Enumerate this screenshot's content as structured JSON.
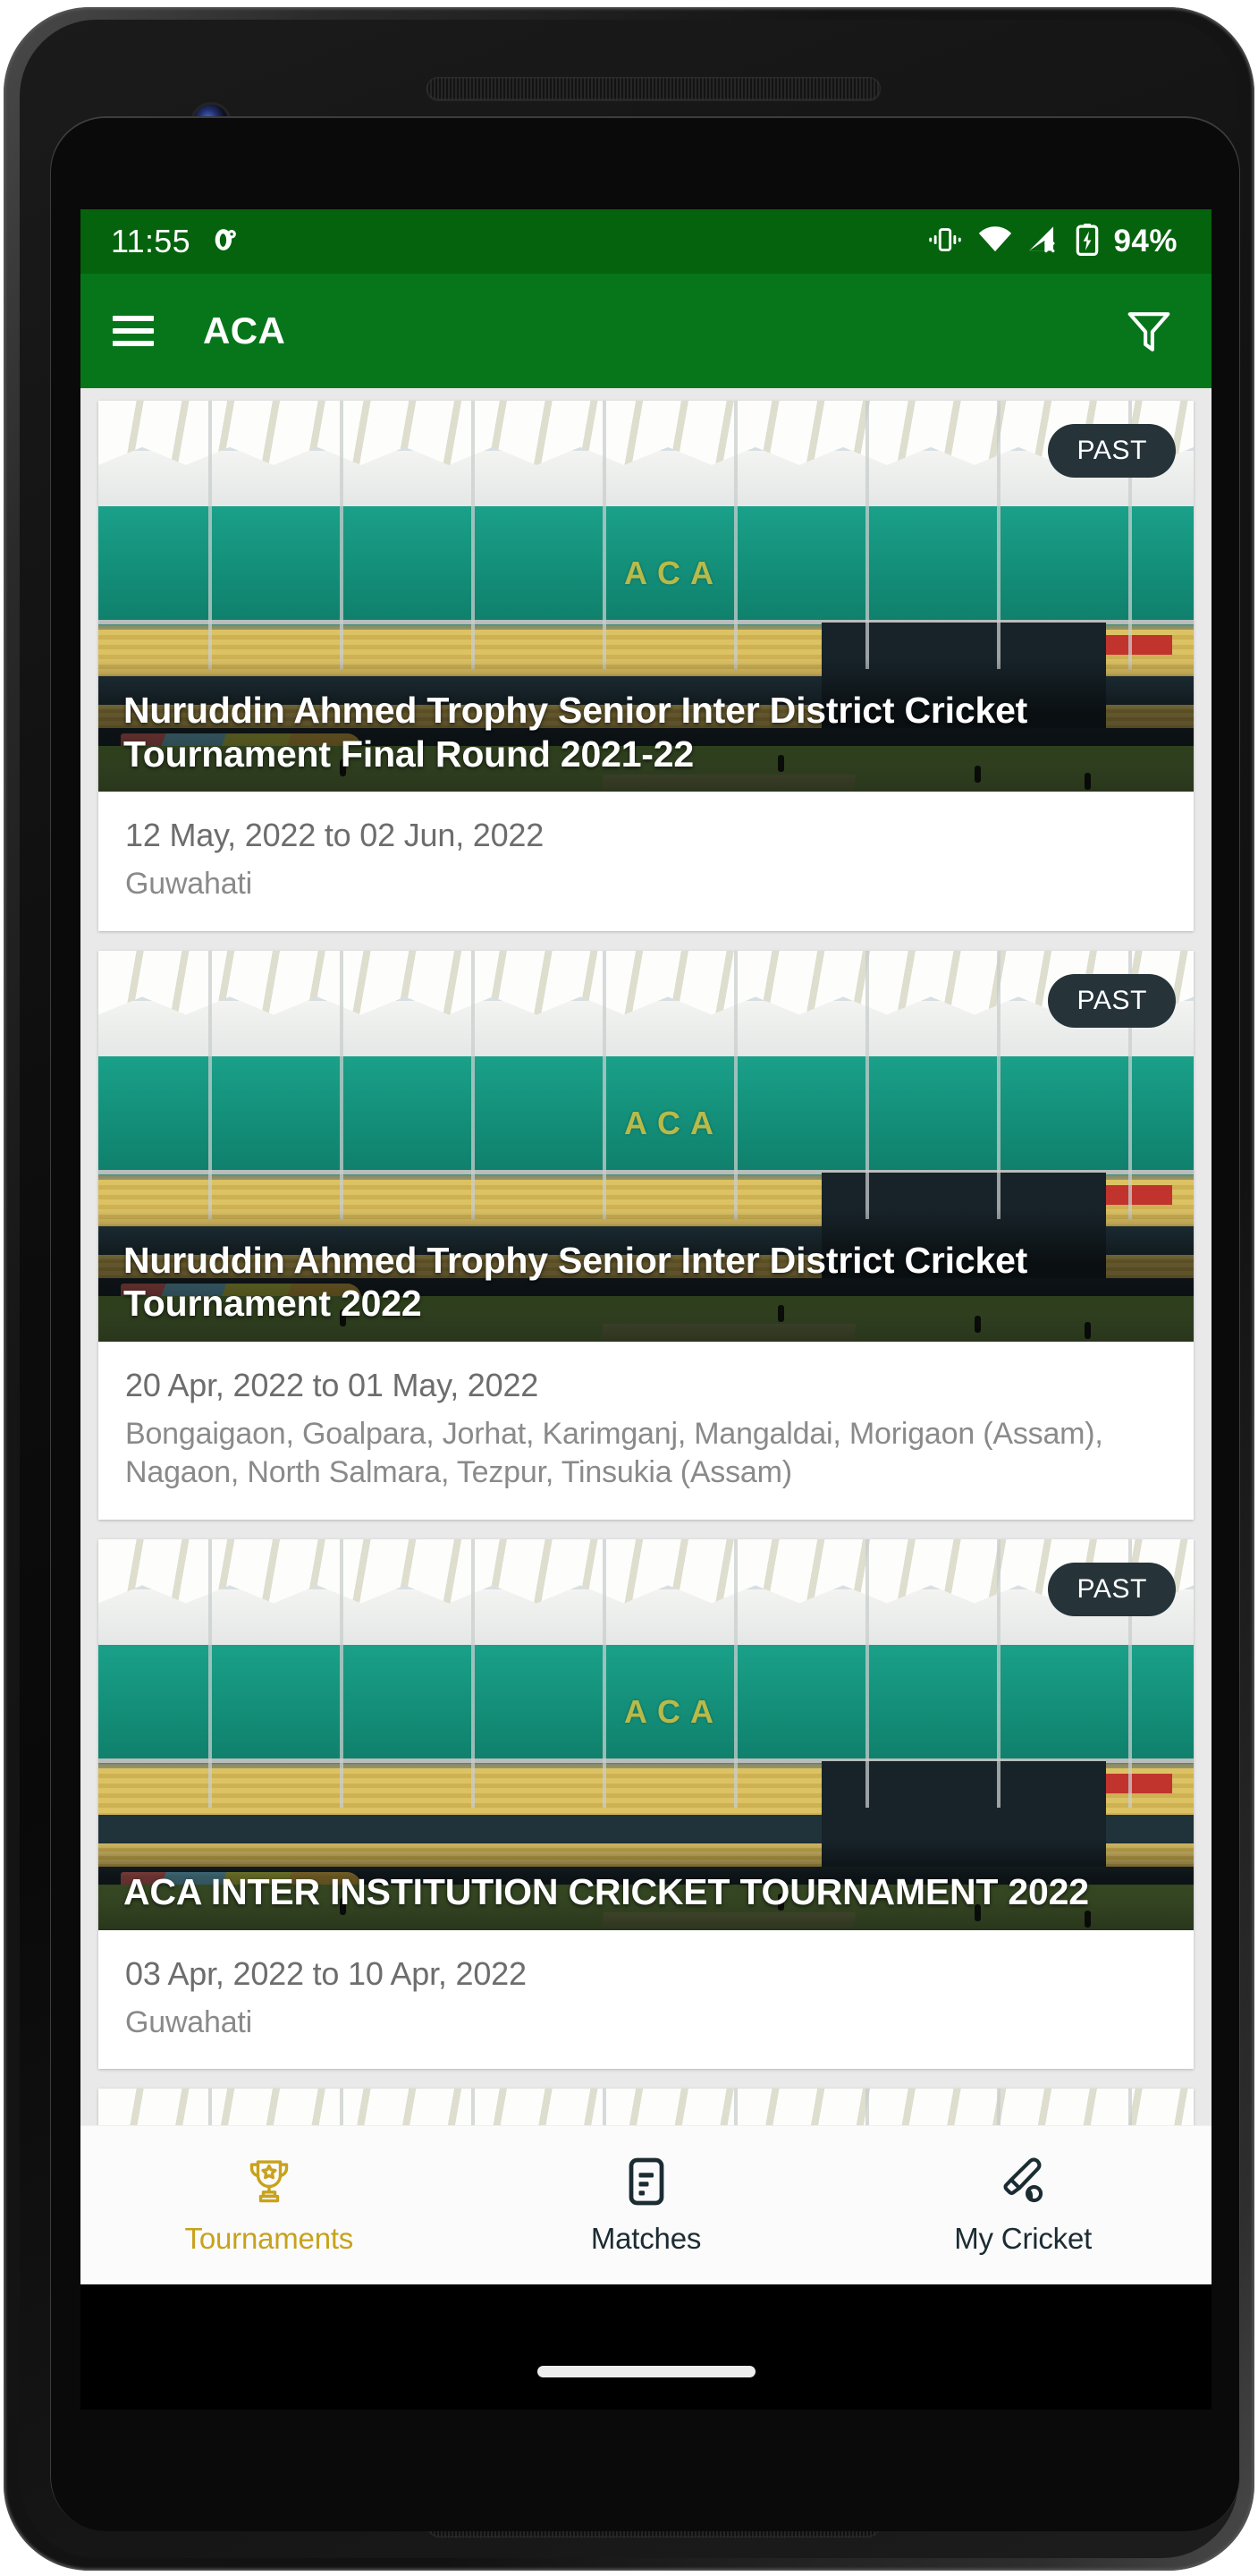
{
  "status_bar": {
    "time": "11:55",
    "notification_icon": "clock-notification-icon",
    "vibrate_icon": "vibrate-icon",
    "wifi_icon": "wifi-icon",
    "cellular_icon": "cellular-no-service-icon",
    "battery_icon": "battery-charging-icon",
    "battery_percent": "94%",
    "bg_color": "#04630c"
  },
  "app_bar": {
    "menu_icon": "hamburger-menu-icon",
    "title": "ACA",
    "filter_icon": "filter-funnel-icon",
    "bg_color": "#07761b"
  },
  "tournaments": [
    {
      "badge": "PAST",
      "title": "Nuruddin Ahmed Trophy Senior Inter District Cricket Tournament Final Round 2021-22",
      "dates": "12 May, 2022  to 02 Jun, 2022",
      "venue": "Guwahati"
    },
    {
      "badge": "PAST",
      "title": "Nuruddin Ahmed Trophy Senior Inter District Cricket Tournament 2022",
      "dates": "20 Apr, 2022  to 01 May, 2022",
      "venue": "Bongaigaon, Goalpara, Jorhat, Karimganj, Mangaldai, Morigaon (Assam), Nagaon, North Salmara, Tezpur, Tinsukia (Assam)"
    },
    {
      "badge": "PAST",
      "title": "ACA INTER INSTITUTION CRICKET TOURNAMENT 2022",
      "dates": "03 Apr, 2022  to 10 Apr, 2022",
      "venue": "Guwahati"
    }
  ],
  "stadium_image": {
    "signage_text": "ACA"
  },
  "bottom_nav": {
    "items": [
      {
        "label": "Tournaments",
        "icon": "trophy-icon",
        "active": true,
        "color": "#c8a21c"
      },
      {
        "label": "Matches",
        "icon": "match-list-icon",
        "active": false,
        "color": "#1c2c33"
      },
      {
        "label": "My Cricket",
        "icon": "cricket-bat-ball-icon",
        "active": false,
        "color": "#1c2c33"
      }
    ]
  }
}
